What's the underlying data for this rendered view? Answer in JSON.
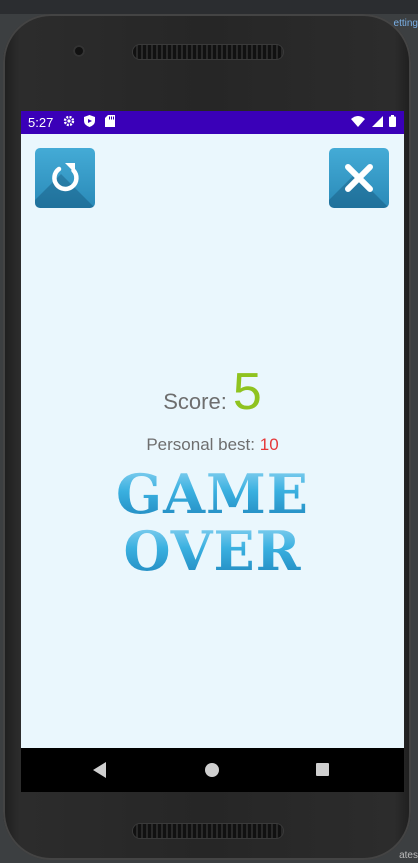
{
  "ide": {
    "tab_text": "etting",
    "bottom_text": "ates"
  },
  "status_bar": {
    "time": "5:27",
    "left_icons": [
      "gear-icon",
      "shield-icon",
      "sd-card-icon"
    ],
    "right_icons": [
      "wifi-icon",
      "signal-icon",
      "battery-icon"
    ],
    "background": "#3a00b8"
  },
  "toolbar": {
    "restart_icon": "restart-icon",
    "close_icon": "close-icon",
    "button_color": "#2f9ac9"
  },
  "result": {
    "score_label": "Score:",
    "score_value": "5",
    "best_label": "Personal best:",
    "best_value": "10",
    "game_over_line1": "GAME",
    "game_over_line2": "OVER",
    "score_color": "#8fc31f",
    "best_color": "#e5393a",
    "background": "#eaf7fd"
  },
  "nav_bar": {
    "back_icon": "back-icon",
    "home_icon": "home-icon",
    "recents_icon": "recents-icon"
  }
}
